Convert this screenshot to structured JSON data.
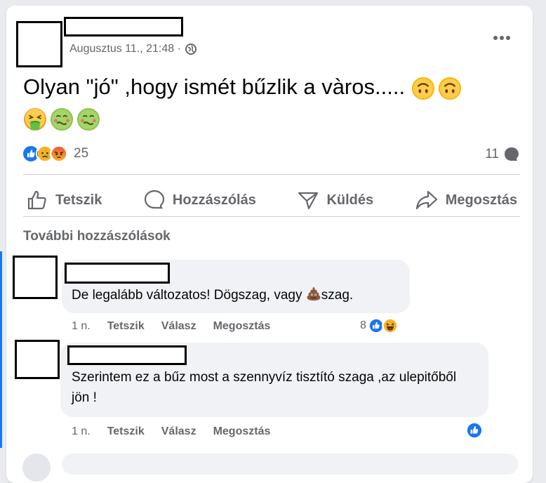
{
  "post": {
    "timestamp": "Augusztus 11., 21:48 ·",
    "text": "Olyan \"jó\" ,hogy ismét bűzlik a vàros.....",
    "reaction_count": "25",
    "comment_count": "11"
  },
  "actions": {
    "like": "Tetszik",
    "comment": "Hozzászólás",
    "send": "Küldés",
    "share": "Megosztás"
  },
  "more_comments_label": "További hozzászólások",
  "comments": [
    {
      "text_before": "De legalább változatos! Dögszag, vagy ",
      "text_after": "szag.",
      "time": "1 n.",
      "like": "Tetszik",
      "reply": "Válasz",
      "share": "Megosztás",
      "reaction_count": "8"
    },
    {
      "text": "Szerintem ez a bűz most a szennyvíz tisztító szaga ,az ulepitőből jön !",
      "time": "1 n.",
      "like": "Tetszik",
      "reply": "Válasz",
      "share": "Megosztás"
    }
  ],
  "colors": {
    "accent": "#1877f2",
    "secondary_text": "#65676b",
    "bubble": "#f0f2f5"
  }
}
